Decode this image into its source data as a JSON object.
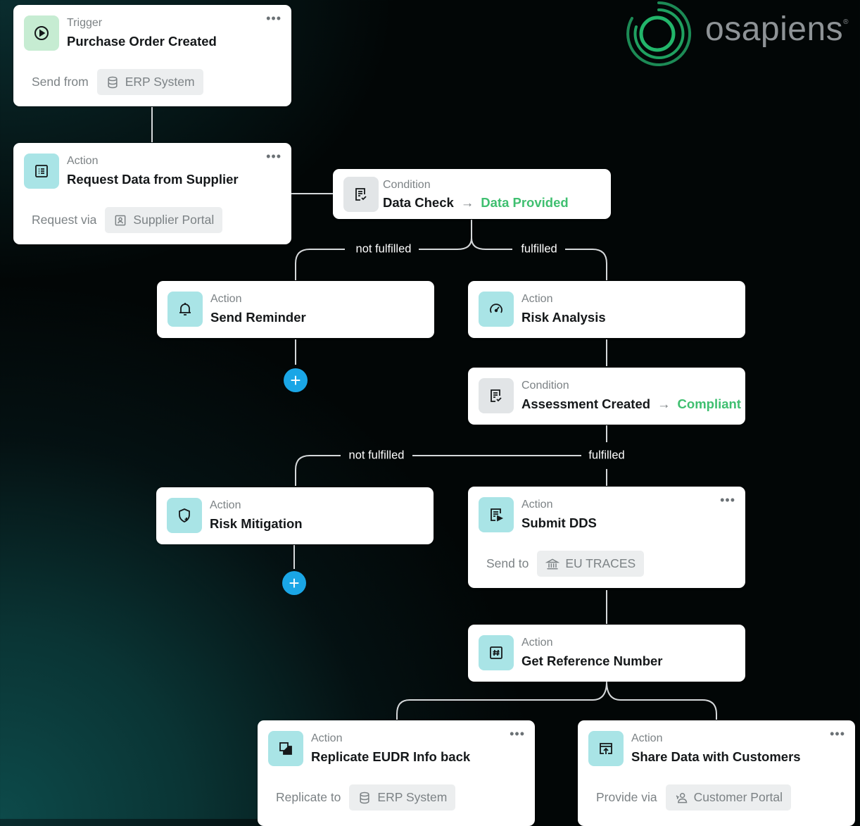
{
  "brand": {
    "name": "osapiens",
    "reg_mark": "®"
  },
  "colors": {
    "trigger_icon_bg": "#c6ecd2",
    "action_icon_bg": "#a9e4e6",
    "condition_icon_bg": "#e2e5e7",
    "outcome": "#3fbf70",
    "add_button": "#1aa6e6"
  },
  "nodes": {
    "trigger": {
      "kind": "Trigger",
      "title": "Purchase Order Created",
      "meta_label": "Send from",
      "pill": "ERP System",
      "icon": "play-circle-icon",
      "more": "•••"
    },
    "request": {
      "kind": "Action",
      "title": "Request Data from Supplier",
      "meta_label": "Request via",
      "pill": "Supplier Portal",
      "icon": "list-icon",
      "more": "•••"
    },
    "data_check": {
      "kind": "Condition",
      "title": "Data Check",
      "arrow": "→",
      "outcome": "Data Provided",
      "icon": "checklist-icon"
    },
    "reminder": {
      "kind": "Action",
      "title": "Send Reminder",
      "icon": "bell-icon"
    },
    "risk_analysis": {
      "kind": "Action",
      "title": "Risk Analysis",
      "icon": "gauge-icon"
    },
    "assessment": {
      "kind": "Condition",
      "title": "Assessment Created",
      "arrow": "→",
      "outcome": "Compliant",
      "icon": "checklist-icon"
    },
    "mitigation": {
      "kind": "Action",
      "title": "Risk Mitigation",
      "icon": "shield-plus-icon"
    },
    "submit": {
      "kind": "Action",
      "title": "Submit DDS",
      "meta_label": "Send to",
      "pill": "EU TRACES",
      "icon": "send-doc-icon",
      "more": "•••"
    },
    "reference": {
      "kind": "Action",
      "title": "Get Reference Number",
      "icon": "hash-icon"
    },
    "replicate": {
      "kind": "Action",
      "title": "Replicate EUDR Info back",
      "meta_label": "Replicate to",
      "pill": "ERP System",
      "icon": "copy-icon",
      "more": "•••"
    },
    "share": {
      "kind": "Action",
      "title": "Share Data with Customers",
      "meta_label": "Provide via",
      "pill": "Customer Portal",
      "icon": "share-upload-icon",
      "more": "•••"
    }
  },
  "edges": {
    "check_not_fulfilled": "not fulfilled",
    "check_fulfilled": "fulfilled",
    "assess_not_fulfilled": "not fulfilled",
    "assess_fulfilled": "fulfilled",
    "add_symbol": "+"
  }
}
